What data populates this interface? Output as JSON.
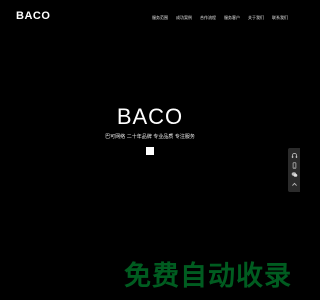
{
  "header": {
    "logo": "BACO",
    "nav": [
      {
        "label": "服务范围"
      },
      {
        "label": "成功案例"
      },
      {
        "label": "合作流程"
      },
      {
        "label": "服务客户"
      },
      {
        "label": "关于我们"
      },
      {
        "label": "联系我们"
      }
    ]
  },
  "hero": {
    "title": "BACO",
    "subtitle": "巴可网络 二十年品牌 专业品质 专注服务"
  },
  "side_tools": [
    {
      "icon": "headset-icon"
    },
    {
      "icon": "phone-icon"
    },
    {
      "icon": "wechat-icon"
    },
    {
      "icon": "arrow-up-icon"
    }
  ],
  "watermark": {
    "text": "免费自动收录"
  },
  "colors": {
    "background": "#000000",
    "text": "#ffffff",
    "sidebar": "#2b2b2b",
    "watermark": "#00a83a"
  }
}
